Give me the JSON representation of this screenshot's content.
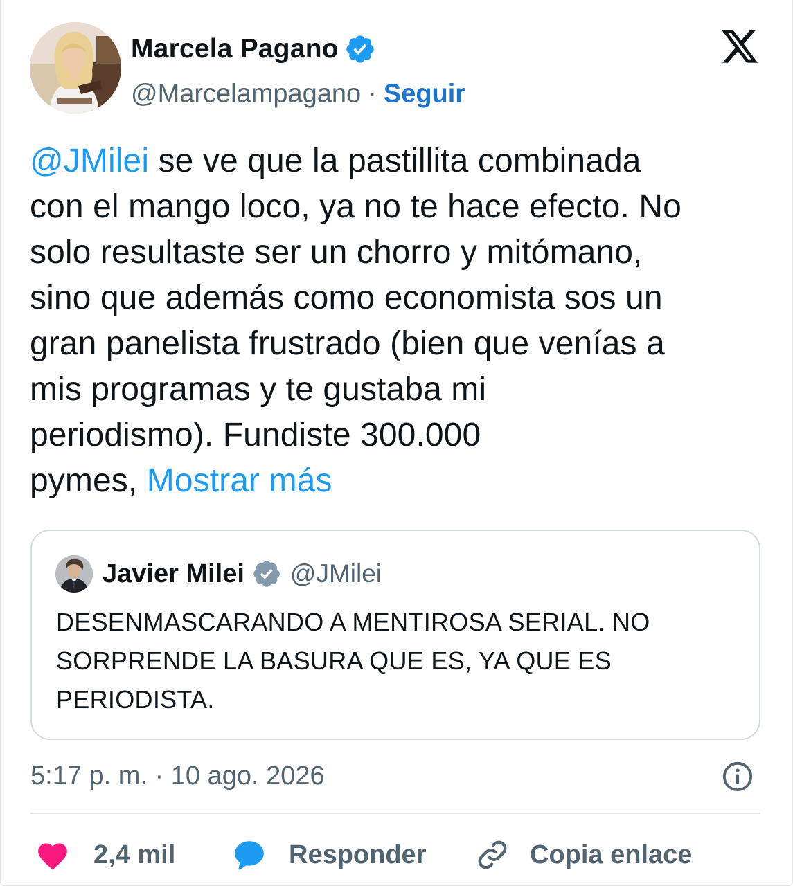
{
  "author": {
    "name": "Marcela Pagano",
    "handle": "@Marcelampagano",
    "separator": "·",
    "follow_label": "Seguir"
  },
  "tweet": {
    "lines": [
      {
        "mention": "@JMilei",
        "text": " se ve que la pastillita combinada"
      },
      {
        "text": "con el mango loco, ya no te hace efecto. No"
      },
      {
        "text": "solo resultaste ser un chorro y mitómano,"
      },
      {
        "text": "sino que además como economista sos un"
      },
      {
        "text": "gran panelista frustrado (bien que venías a"
      },
      {
        "text": "mis programas y te gustaba mi"
      },
      {
        "text": "periodismo). Fundiste 300.000"
      },
      {
        "text": "pymes, ",
        "show_more": "Mostrar más"
      }
    ]
  },
  "quoted": {
    "name": "Javier Milei",
    "handle": "@JMilei",
    "lines": [
      "DESENMASCARANDO A MENTIROSA SERIAL. NO",
      "SORPRENDE LA BASURA QUE ES, YA QUE ES",
      "PERIODISTA."
    ]
  },
  "timestamp": "5:17 p. m. · 10 ago. 2026",
  "actions": {
    "likes": "2,4 mil",
    "reply_label": "Responder",
    "copy_label": "Copia enlace"
  },
  "colors": {
    "link": "#1d9bf0",
    "follow": "#1d74d0",
    "verified": "#1d9bf0",
    "quoted_verified": "#829aab",
    "heart": "#f91880",
    "secondary_text": "#536471"
  },
  "icons": [
    "verified-badge-icon",
    "x-logo-icon",
    "info-icon",
    "heart-icon",
    "reply-bubble-icon",
    "link-icon"
  ]
}
